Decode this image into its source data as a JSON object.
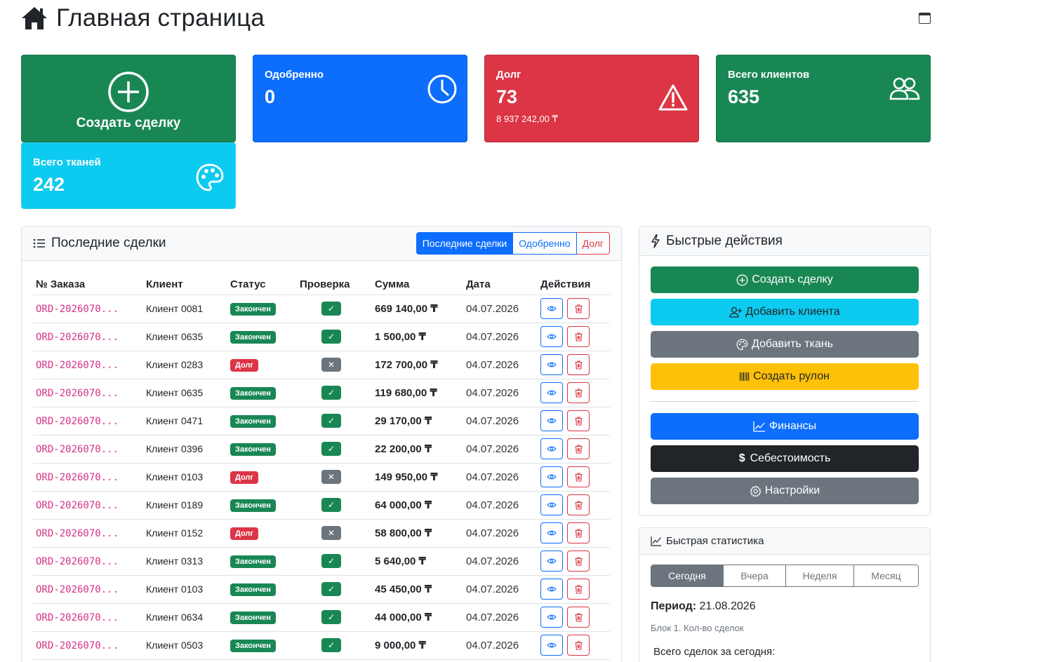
{
  "header": {
    "title": "Главная страница"
  },
  "cards": {
    "create": {
      "label": "Создать сделку"
    },
    "approved": {
      "title": "Одобренно",
      "value": "0"
    },
    "debt": {
      "title": "Долг",
      "value": "73",
      "sub": "8 937 242,00 ₸"
    },
    "clients": {
      "title": "Всего клиентов",
      "value": "635"
    },
    "fabrics": {
      "title": "Всего тканей",
      "value": "242"
    }
  },
  "deals": {
    "title": "Последние сделки",
    "tabs": [
      "Последние сделки",
      "Одобренно",
      "Долг"
    ],
    "columns": [
      "№ Заказа",
      "Клиент",
      "Статус",
      "Проверка",
      "Сумма",
      "Дата",
      "Действия"
    ],
    "rows": [
      {
        "order": "ORD-2026070...",
        "client": "Клиент 0081",
        "status": "Закончен",
        "status_type": "done",
        "check": "ok",
        "amount": "669 140,00 ₸",
        "date": "04.07.2026"
      },
      {
        "order": "ORD-2026070...",
        "client": "Клиент 0635",
        "status": "Закончен",
        "status_type": "done",
        "check": "ok",
        "amount": "1 500,00 ₸",
        "date": "04.07.2026"
      },
      {
        "order": "ORD-2026070...",
        "client": "Клиент 0283",
        "status": "Долг",
        "status_type": "debt",
        "check": "no",
        "amount": "172 700,00 ₸",
        "date": "04.07.2026"
      },
      {
        "order": "ORD-2026070...",
        "client": "Клиент 0635",
        "status": "Закончен",
        "status_type": "done",
        "check": "ok",
        "amount": "119 680,00 ₸",
        "date": "04.07.2026"
      },
      {
        "order": "ORD-2026070...",
        "client": "Клиент 0471",
        "status": "Закончен",
        "status_type": "done",
        "check": "ok",
        "amount": "29 170,00 ₸",
        "date": "04.07.2026"
      },
      {
        "order": "ORD-2026070...",
        "client": "Клиент 0396",
        "status": "Закончен",
        "status_type": "done",
        "check": "ok",
        "amount": "22 200,00 ₸",
        "date": "04.07.2026"
      },
      {
        "order": "ORD-2026070...",
        "client": "Клиент 0103",
        "status": "Долг",
        "status_type": "debt",
        "check": "no",
        "amount": "149 950,00 ₸",
        "date": "04.07.2026"
      },
      {
        "order": "ORD-2026070...",
        "client": "Клиент 0189",
        "status": "Закончен",
        "status_type": "done",
        "check": "ok",
        "amount": "64 000,00 ₸",
        "date": "04.07.2026"
      },
      {
        "order": "ORD-2026070...",
        "client": "Клиент 0152",
        "status": "Долг",
        "status_type": "debt",
        "check": "no",
        "amount": "58 800,00 ₸",
        "date": "04.07.2026"
      },
      {
        "order": "ORD-2026070...",
        "client": "Клиент 0313",
        "status": "Закончен",
        "status_type": "done",
        "check": "ok",
        "amount": "5 640,00 ₸",
        "date": "04.07.2026"
      },
      {
        "order": "ORD-2026070...",
        "client": "Клиент 0103",
        "status": "Закончен",
        "status_type": "done",
        "check": "ok",
        "amount": "45 450,00 ₸",
        "date": "04.07.2026"
      },
      {
        "order": "ORD-2026070...",
        "client": "Клиент 0634",
        "status": "Закончен",
        "status_type": "done",
        "check": "ok",
        "amount": "44 000,00 ₸",
        "date": "04.07.2026"
      },
      {
        "order": "ORD-2026070...",
        "client": "Клиент 0503",
        "status": "Закончен",
        "status_type": "done",
        "check": "ok",
        "amount": "9 000,00 ₸",
        "date": "04.07.2026"
      }
    ]
  },
  "quick_actions": {
    "title": "Быстрые действия",
    "create_deal": "Создать сделку",
    "add_client": "Добавить клиента",
    "add_fabric": "Добавить ткань",
    "create_roll": "Создать рулон",
    "finance": "Финансы",
    "cost": "Себестоимость",
    "settings": "Настройки"
  },
  "stats": {
    "title": "Быстрая статистика",
    "periods": [
      "Сегодня",
      "Вчера",
      "Неделя",
      "Месяц"
    ],
    "active_period": "Сегодня",
    "period_label": "Период:",
    "period_value": "21.08.2026",
    "block_label": "Блок 1. Кол-во сделок",
    "total_label": "Всего сделок за сегодня:"
  },
  "colors": {
    "success": "#198754",
    "primary": "#0d6efd",
    "danger": "#dc3545",
    "info": "#0dcaf0",
    "warning": "#ffc107",
    "secondary": "#6c757d",
    "dark": "#212529",
    "order_link": "#d63384"
  }
}
